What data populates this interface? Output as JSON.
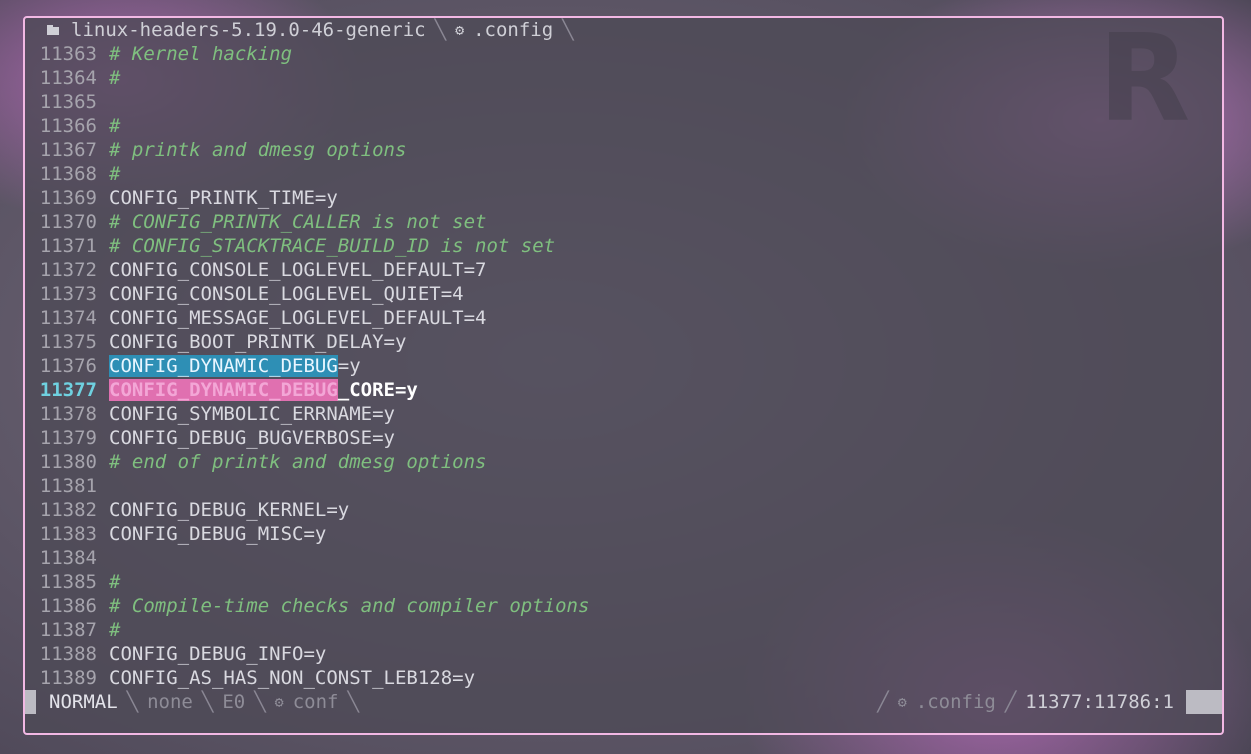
{
  "tabline": {
    "folder": "linux-headers-5.19.0-46-generic",
    "file": ".config"
  },
  "lines": [
    {
      "num": "11363",
      "text": "# Kernel hacking",
      "kind": "comment"
    },
    {
      "num": "11364",
      "text": "#",
      "kind": "comment"
    },
    {
      "num": "11365",
      "text": "",
      "kind": "plain"
    },
    {
      "num": "11366",
      "text": "#",
      "kind": "comment"
    },
    {
      "num": "11367",
      "text": "# printk and dmesg options",
      "kind": "comment"
    },
    {
      "num": "11368",
      "text": "#",
      "kind": "comment"
    },
    {
      "num": "11369",
      "text": "CONFIG_PRINTK_TIME=y",
      "kind": "plain"
    },
    {
      "num": "11370",
      "text": "# CONFIG_PRINTK_CALLER is not set",
      "kind": "comment"
    },
    {
      "num": "11371",
      "text": "# CONFIG_STACKTRACE_BUILD_ID is not set",
      "kind": "comment"
    },
    {
      "num": "11372",
      "text": "CONFIG_CONSOLE_LOGLEVEL_DEFAULT=7",
      "kind": "plain"
    },
    {
      "num": "11373",
      "text": "CONFIG_CONSOLE_LOGLEVEL_QUIET=4",
      "kind": "plain"
    },
    {
      "num": "11374",
      "text": "CONFIG_MESSAGE_LOGLEVEL_DEFAULT=4",
      "kind": "plain"
    },
    {
      "num": "11375",
      "text": "CONFIG_BOOT_PRINTK_DELAY=y",
      "kind": "plain"
    },
    {
      "num": "11376",
      "match": "CONFIG_DYNAMIC_DEBUG",
      "rest": "=y",
      "kind": "search"
    },
    {
      "num": "11377",
      "match": "CONFIG_DYNAMIC_DEBUG",
      "rest": "_CORE=y",
      "kind": "cursor"
    },
    {
      "num": "11378",
      "text": "CONFIG_SYMBOLIC_ERRNAME=y",
      "kind": "plain"
    },
    {
      "num": "11379",
      "text": "CONFIG_DEBUG_BUGVERBOSE=y",
      "kind": "plain"
    },
    {
      "num": "11380",
      "text": "# end of printk and dmesg options",
      "kind": "comment"
    },
    {
      "num": "11381",
      "text": "",
      "kind": "plain"
    },
    {
      "num": "11382",
      "text": "CONFIG_DEBUG_KERNEL=y",
      "kind": "plain"
    },
    {
      "num": "11383",
      "text": "CONFIG_DEBUG_MISC=y",
      "kind": "plain"
    },
    {
      "num": "11384",
      "text": "",
      "kind": "plain"
    },
    {
      "num": "11385",
      "text": "#",
      "kind": "comment"
    },
    {
      "num": "11386",
      "text": "# Compile-time checks and compiler options",
      "kind": "comment"
    },
    {
      "num": "11387",
      "text": "#",
      "kind": "comment"
    },
    {
      "num": "11388",
      "text": "CONFIG_DEBUG_INFO=y",
      "kind": "plain"
    },
    {
      "num": "11389",
      "text": "CONFIG_AS_HAS_NON_CONST_LEB128=y",
      "kind": "plain"
    }
  ],
  "status": {
    "mode": "NORMAL",
    "git": "none",
    "errors": "E0",
    "filetype": "conf",
    "file": ".config",
    "position": "11377:11786:1"
  },
  "colors": {
    "border": "#f2b8e4",
    "search_highlight": "#2e8fb5",
    "cursor_highlight": "#e070b0",
    "comment": "#7fbf7f",
    "current_line_number": "#6fd1e0"
  }
}
